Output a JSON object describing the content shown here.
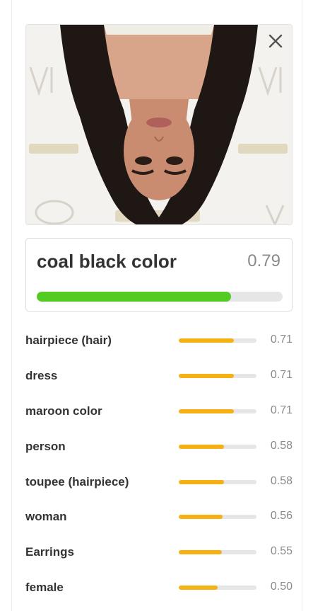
{
  "photo": {
    "description_icon": "portrait-photo",
    "close_icon": "close-icon"
  },
  "top_result": {
    "label": "coal black color",
    "score_text": "0.79",
    "score": 0.79,
    "bar_color": "#52cc23"
  },
  "results": [
    {
      "label": "hairpiece (hair)",
      "score_text": "0.71",
      "score": 0.71
    },
    {
      "label": "dress",
      "score_text": "0.71",
      "score": 0.71
    },
    {
      "label": "maroon color",
      "score_text": "0.71",
      "score": 0.71
    },
    {
      "label": "person",
      "score_text": "0.58",
      "score": 0.58
    },
    {
      "label": "toupee (hairpiece)",
      "score_text": "0.58",
      "score": 0.58
    },
    {
      "label": "woman",
      "score_text": "0.56",
      "score": 0.56
    },
    {
      "label": "Earrings",
      "score_text": "0.55",
      "score": 0.55
    },
    {
      "label": "female",
      "score_text": "0.50",
      "score": 0.5
    }
  ],
  "colors": {
    "result_bar": "#f5b014",
    "track": "#e6e6e6",
    "label_text": "#333333",
    "score_text": "#8a8a8a"
  }
}
